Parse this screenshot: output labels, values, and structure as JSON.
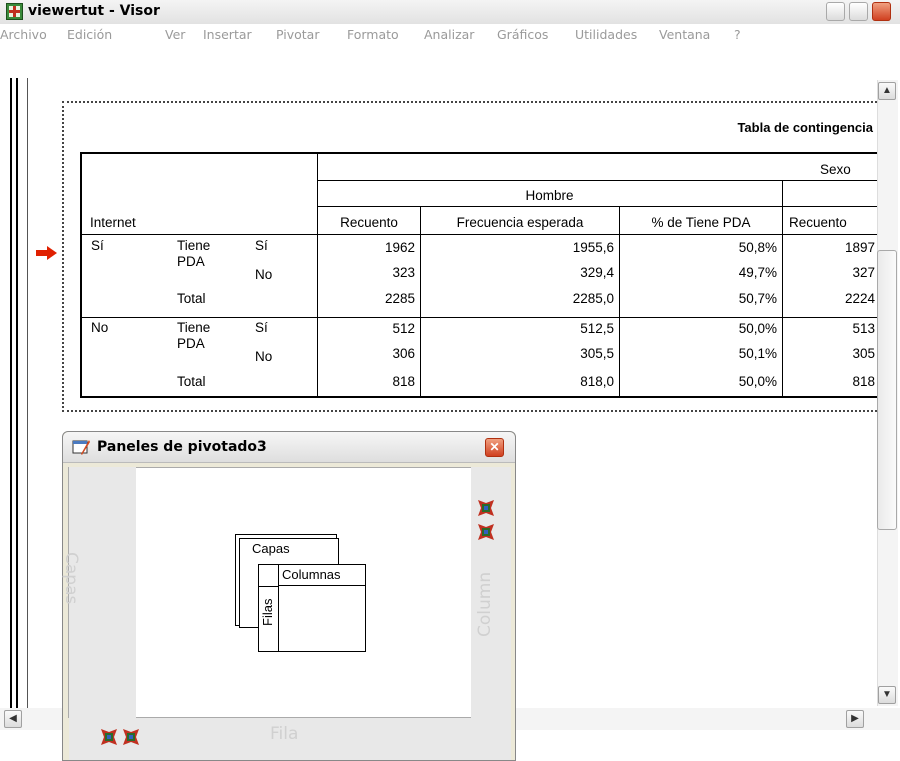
{
  "window": {
    "title": "viewertut - Visor"
  },
  "menu": [
    "Archivo",
    "Edición",
    "Ver",
    "Insertar",
    "Pivotar",
    "Formato",
    "Analizar",
    "Gráficos",
    "Utilidades",
    "Ventana",
    "?"
  ],
  "table": {
    "title": "Tabla de contingencia",
    "group_header": "Sexo",
    "sub_header": "Hombre",
    "row_var": "Internet",
    "columns": [
      "Recuento",
      "Frecuencia esperada",
      "% de Tiene PDA",
      "Recuento"
    ],
    "rows": [
      {
        "internet": "Sí",
        "var": "Tiene",
        "cat": "Sí",
        "vals": [
          "1962",
          "1955,6",
          "50,8%",
          "1897"
        ]
      },
      {
        "internet": "",
        "var": "PDA",
        "cat": "No",
        "vals": [
          "323",
          "329,4",
          "49,7%",
          "327"
        ]
      },
      {
        "internet": "",
        "var": "Total",
        "cat": "",
        "vals": [
          "2285",
          "2285,0",
          "50,7%",
          "2224"
        ]
      },
      {
        "internet": "No",
        "var": "Tiene",
        "cat": "Sí",
        "vals": [
          "512",
          "512,5",
          "50,0%",
          "513"
        ]
      },
      {
        "internet": "",
        "var": "PDA",
        "cat": "No",
        "vals": [
          "306",
          "305,5",
          "50,1%",
          "305"
        ]
      },
      {
        "internet": "",
        "var": "Total",
        "cat": "",
        "vals": [
          "818",
          "818,0",
          "50,0%",
          "818"
        ]
      }
    ]
  },
  "pivot": {
    "title": "Paneles de pivotado3",
    "layers_label": "Capas",
    "columns_label": "Column",
    "rows_label": "Fila",
    "diagram": {
      "layers": "Capas",
      "columns": "Columnas",
      "rows": "Filas"
    }
  },
  "icons": {
    "app": "viewer-icon",
    "arrow": "current-row-arrow-icon",
    "pivot": "pivot-icon"
  },
  "colors": {
    "arrow": "#e02000",
    "close": "#d04020",
    "disabled_menu": "#9a9a9a"
  }
}
